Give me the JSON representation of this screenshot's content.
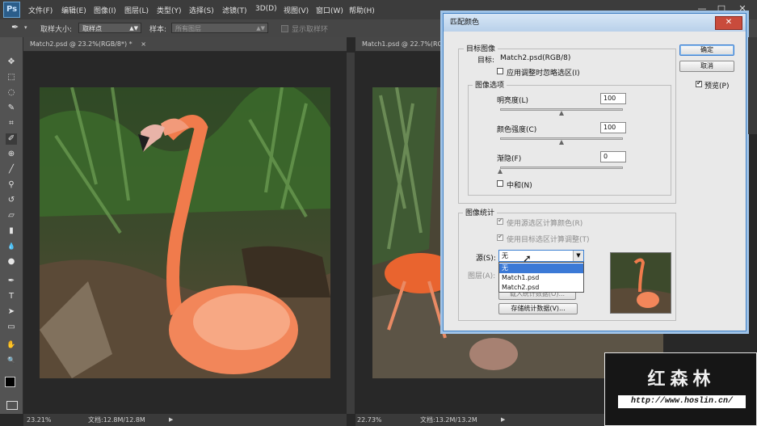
{
  "app": {
    "logo": "Ps"
  },
  "menu": [
    "文件(F)",
    "编辑(E)",
    "图像(I)",
    "图层(L)",
    "类型(Y)",
    "选择(S)",
    "滤镜(T)",
    "3D(D)",
    "视图(V)",
    "窗口(W)",
    "帮助(H)"
  ],
  "window_controls": {
    "minimize": "—",
    "restore": "□",
    "close": "✕"
  },
  "options_bar": {
    "tool_icon": "eyedropper-icon",
    "sample_size_label": "取样大小:",
    "sample_size_value": "取样点",
    "sample_label": "样本:",
    "sample_value": "所有图层",
    "show_ring_label": "显示取样环"
  },
  "tools": [
    "move-icon",
    "marquee-icon",
    "lasso-icon",
    "quick-select-icon",
    "crop-icon",
    "eyedropper-icon",
    "healing-icon",
    "brush-icon",
    "stamp-icon",
    "history-brush-icon",
    "eraser-icon",
    "gradient-icon",
    "blur-icon",
    "dodge-icon",
    "pen-icon",
    "type-icon",
    "path-select-icon",
    "shape-icon",
    "hand-icon",
    "zoom-icon"
  ],
  "tool_glyphs": [
    "✥",
    "⬚",
    "◌",
    "✎",
    "⌗",
    "✐",
    "⊕",
    "╱",
    "⚲",
    "↺",
    "▱",
    "▮",
    "💧",
    "●",
    "✒",
    "T",
    "➤",
    "▭",
    "✋",
    "🔍"
  ],
  "documents": [
    {
      "tab": "Match2.psd @ 23.2%(RGB/8*) *",
      "close": "×",
      "zoom": "23.21%",
      "doc_info": "文档:12.8M/12.8M"
    },
    {
      "tab": "Match1.psd @ 22.7%(RGB/8*)",
      "close": "×",
      "zoom": "22.73%",
      "doc_info": "文档:13.2M/13.2M"
    }
  ],
  "dialog": {
    "title": "匹配颜色",
    "close": "✕",
    "target_group": "目标图像",
    "target_label": "目标:",
    "target_value": "Match2.psd(RGB/8)",
    "ignore_selection_label": "应用调整时忽略选区(I)",
    "options_group": "图像选项",
    "luminance_label": "明亮度(L)",
    "luminance_value": "100",
    "luminance_level": 0.5,
    "color_intensity_label": "颜色强度(C)",
    "color_intensity_value": "100",
    "color_intensity_level": 0.5,
    "fade_label": "渐隐(F)",
    "fade_value": "0",
    "fade_level": 0,
    "neutralize_label": "中和(N)",
    "stats_group": "图像统计",
    "use_source_selection_label": "使用源选区计算颜色(R)",
    "use_target_selection_label": "使用目标选区计算调整(T)",
    "source_label": "源(S):",
    "source_value": "无",
    "source_options": [
      "无",
      "Match1.psd",
      "Match2.psd"
    ],
    "layer_label": "图层(A):",
    "load_stats_label": "载入统计数据(O)...",
    "save_stats_label": "存储统计数据(V)...",
    "ok_label": "确定",
    "cancel_label": "取消",
    "preview_label": "预览(P)"
  },
  "watermark": {
    "title": "红森林",
    "url": "http://www.hoslin.cn/"
  }
}
